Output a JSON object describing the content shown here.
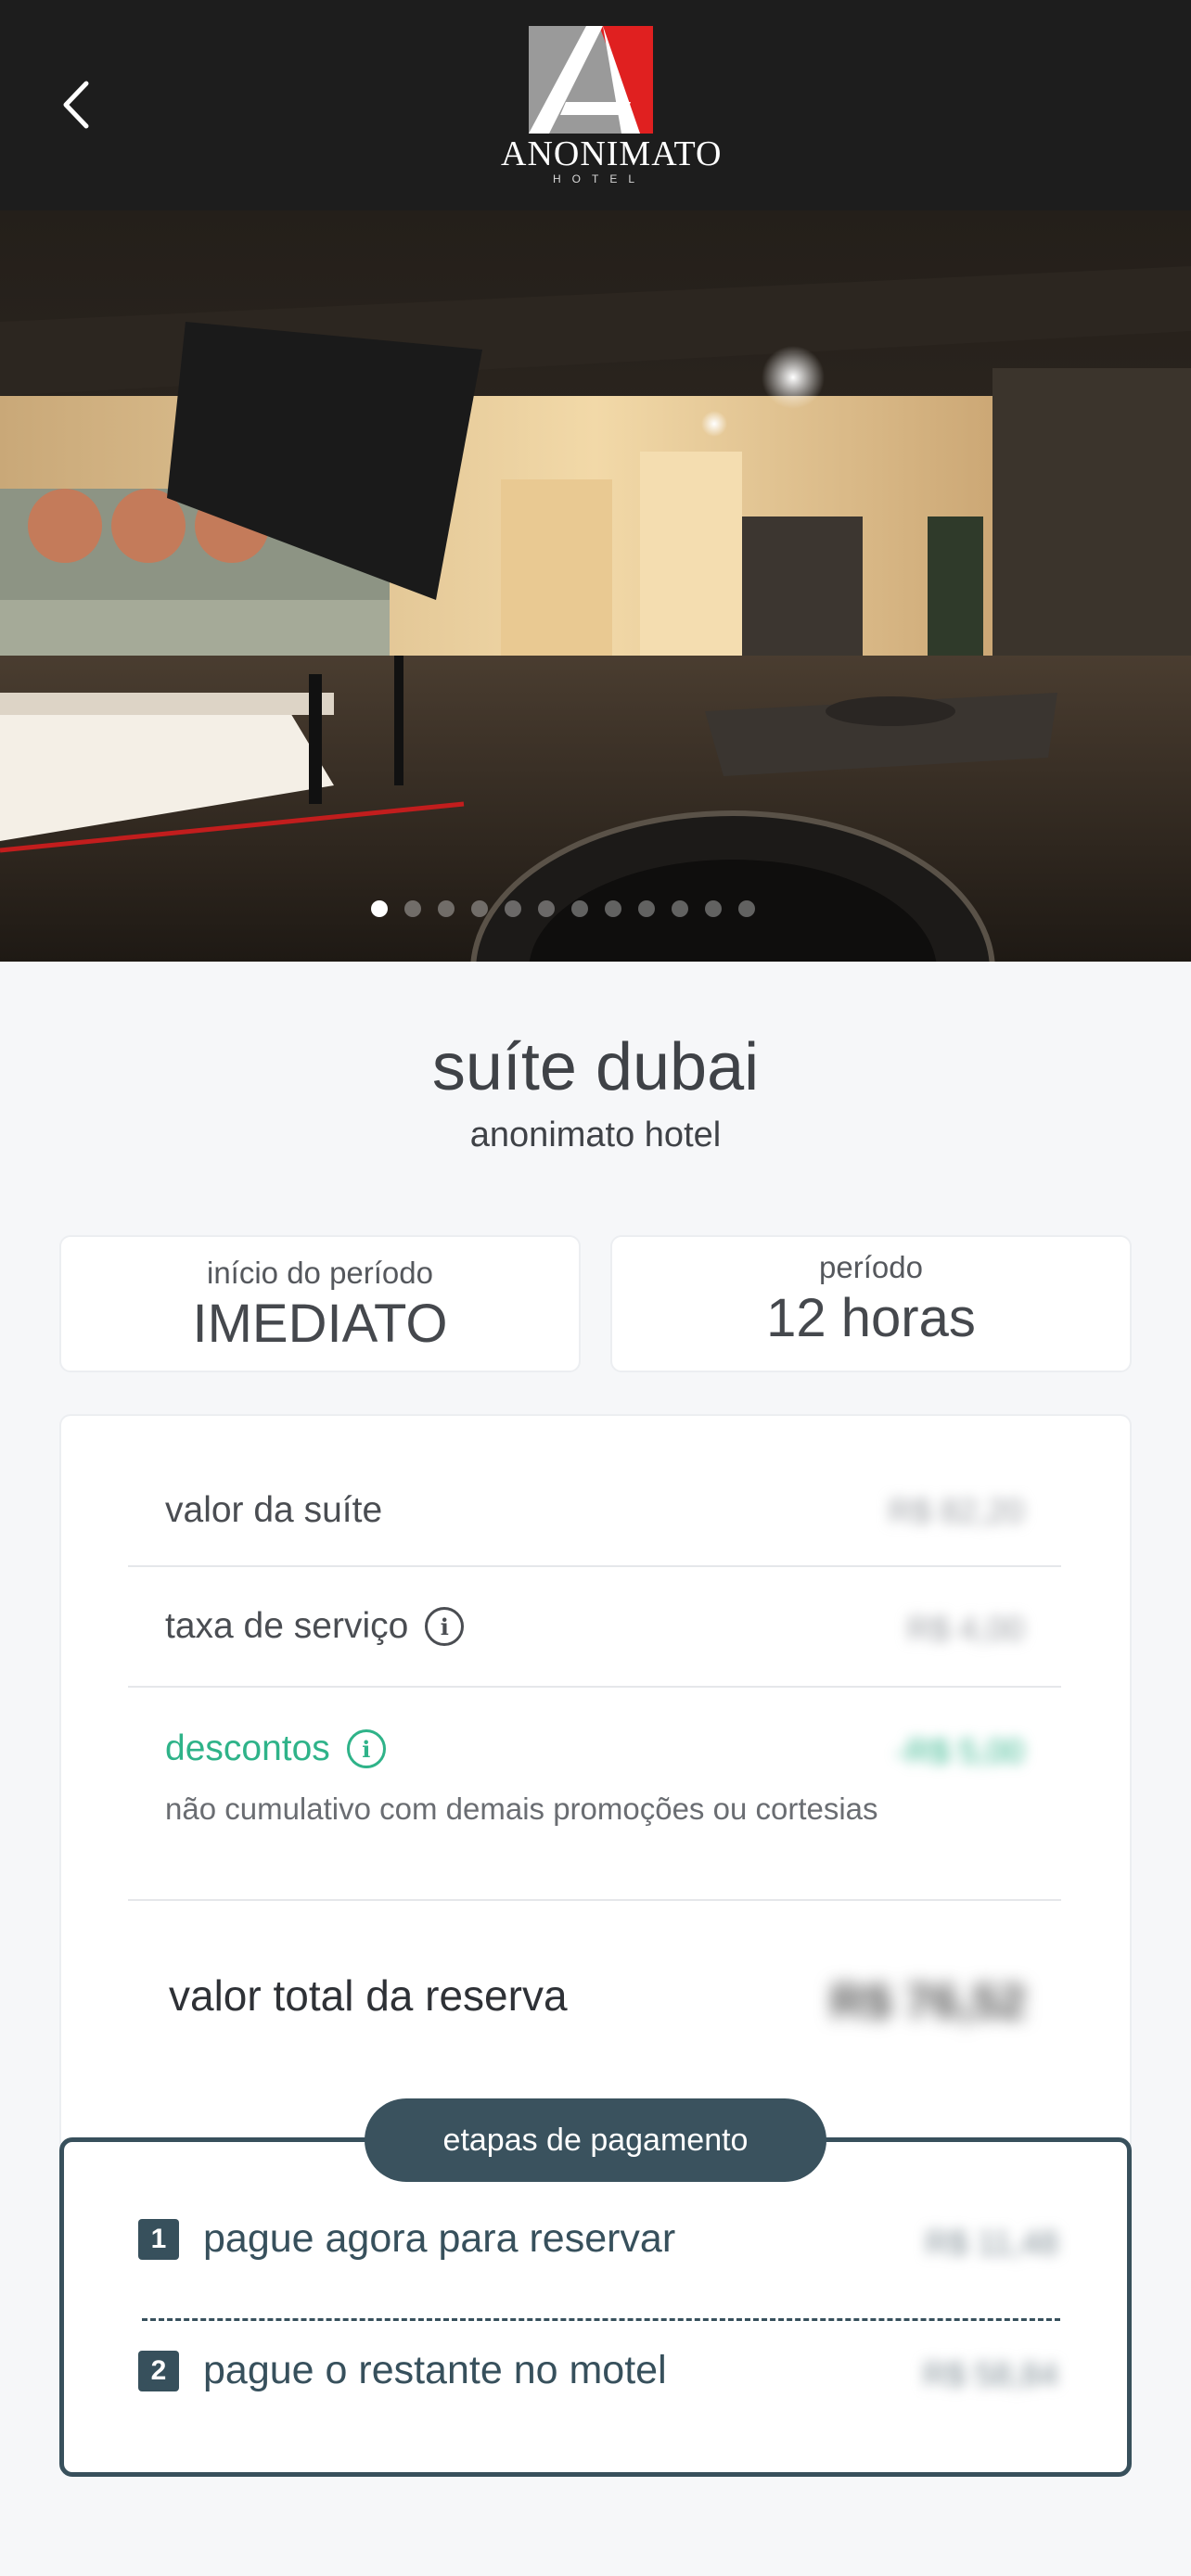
{
  "header": {
    "back_icon": "chevron-left-icon",
    "logo_text": "ANONIMATO",
    "logo_sub": "HOTEL",
    "colors": {
      "background": "#1d1d1d",
      "logo_red": "#e02020",
      "logo_gray": "#9a9a9a"
    }
  },
  "gallery": {
    "total_images": 12,
    "active_index": 0
  },
  "suite": {
    "title": "suíte dubai",
    "hotel": "anonimato hotel"
  },
  "period": {
    "start_label": "início do período",
    "start_value": "IMEDIATO",
    "duration_label": "período",
    "duration_value": "12 horas"
  },
  "pricing": {
    "suite_label": "valor da suíte",
    "suite_value": "R$ 82,20",
    "fee_label": "taxa de serviço",
    "fee_value": "R$ 4,00",
    "discount_label": "descontos",
    "discount_value": "-R$ 5,00",
    "discount_note": "não cumulativo com demais promoções ou cortesias",
    "total_label": "valor total da reserva",
    "total_value": "R$ 76,52",
    "accent_green": "#2fb389"
  },
  "payment_steps": {
    "title": "etapas de pagamento",
    "step1_num": "1",
    "step1_label": "pague agora para reservar",
    "step1_value": "R$ 11,48",
    "step2_num": "2",
    "step2_label": "pague o restante no motel",
    "step2_value": "R$ 58,84",
    "accent": "#37505c"
  }
}
